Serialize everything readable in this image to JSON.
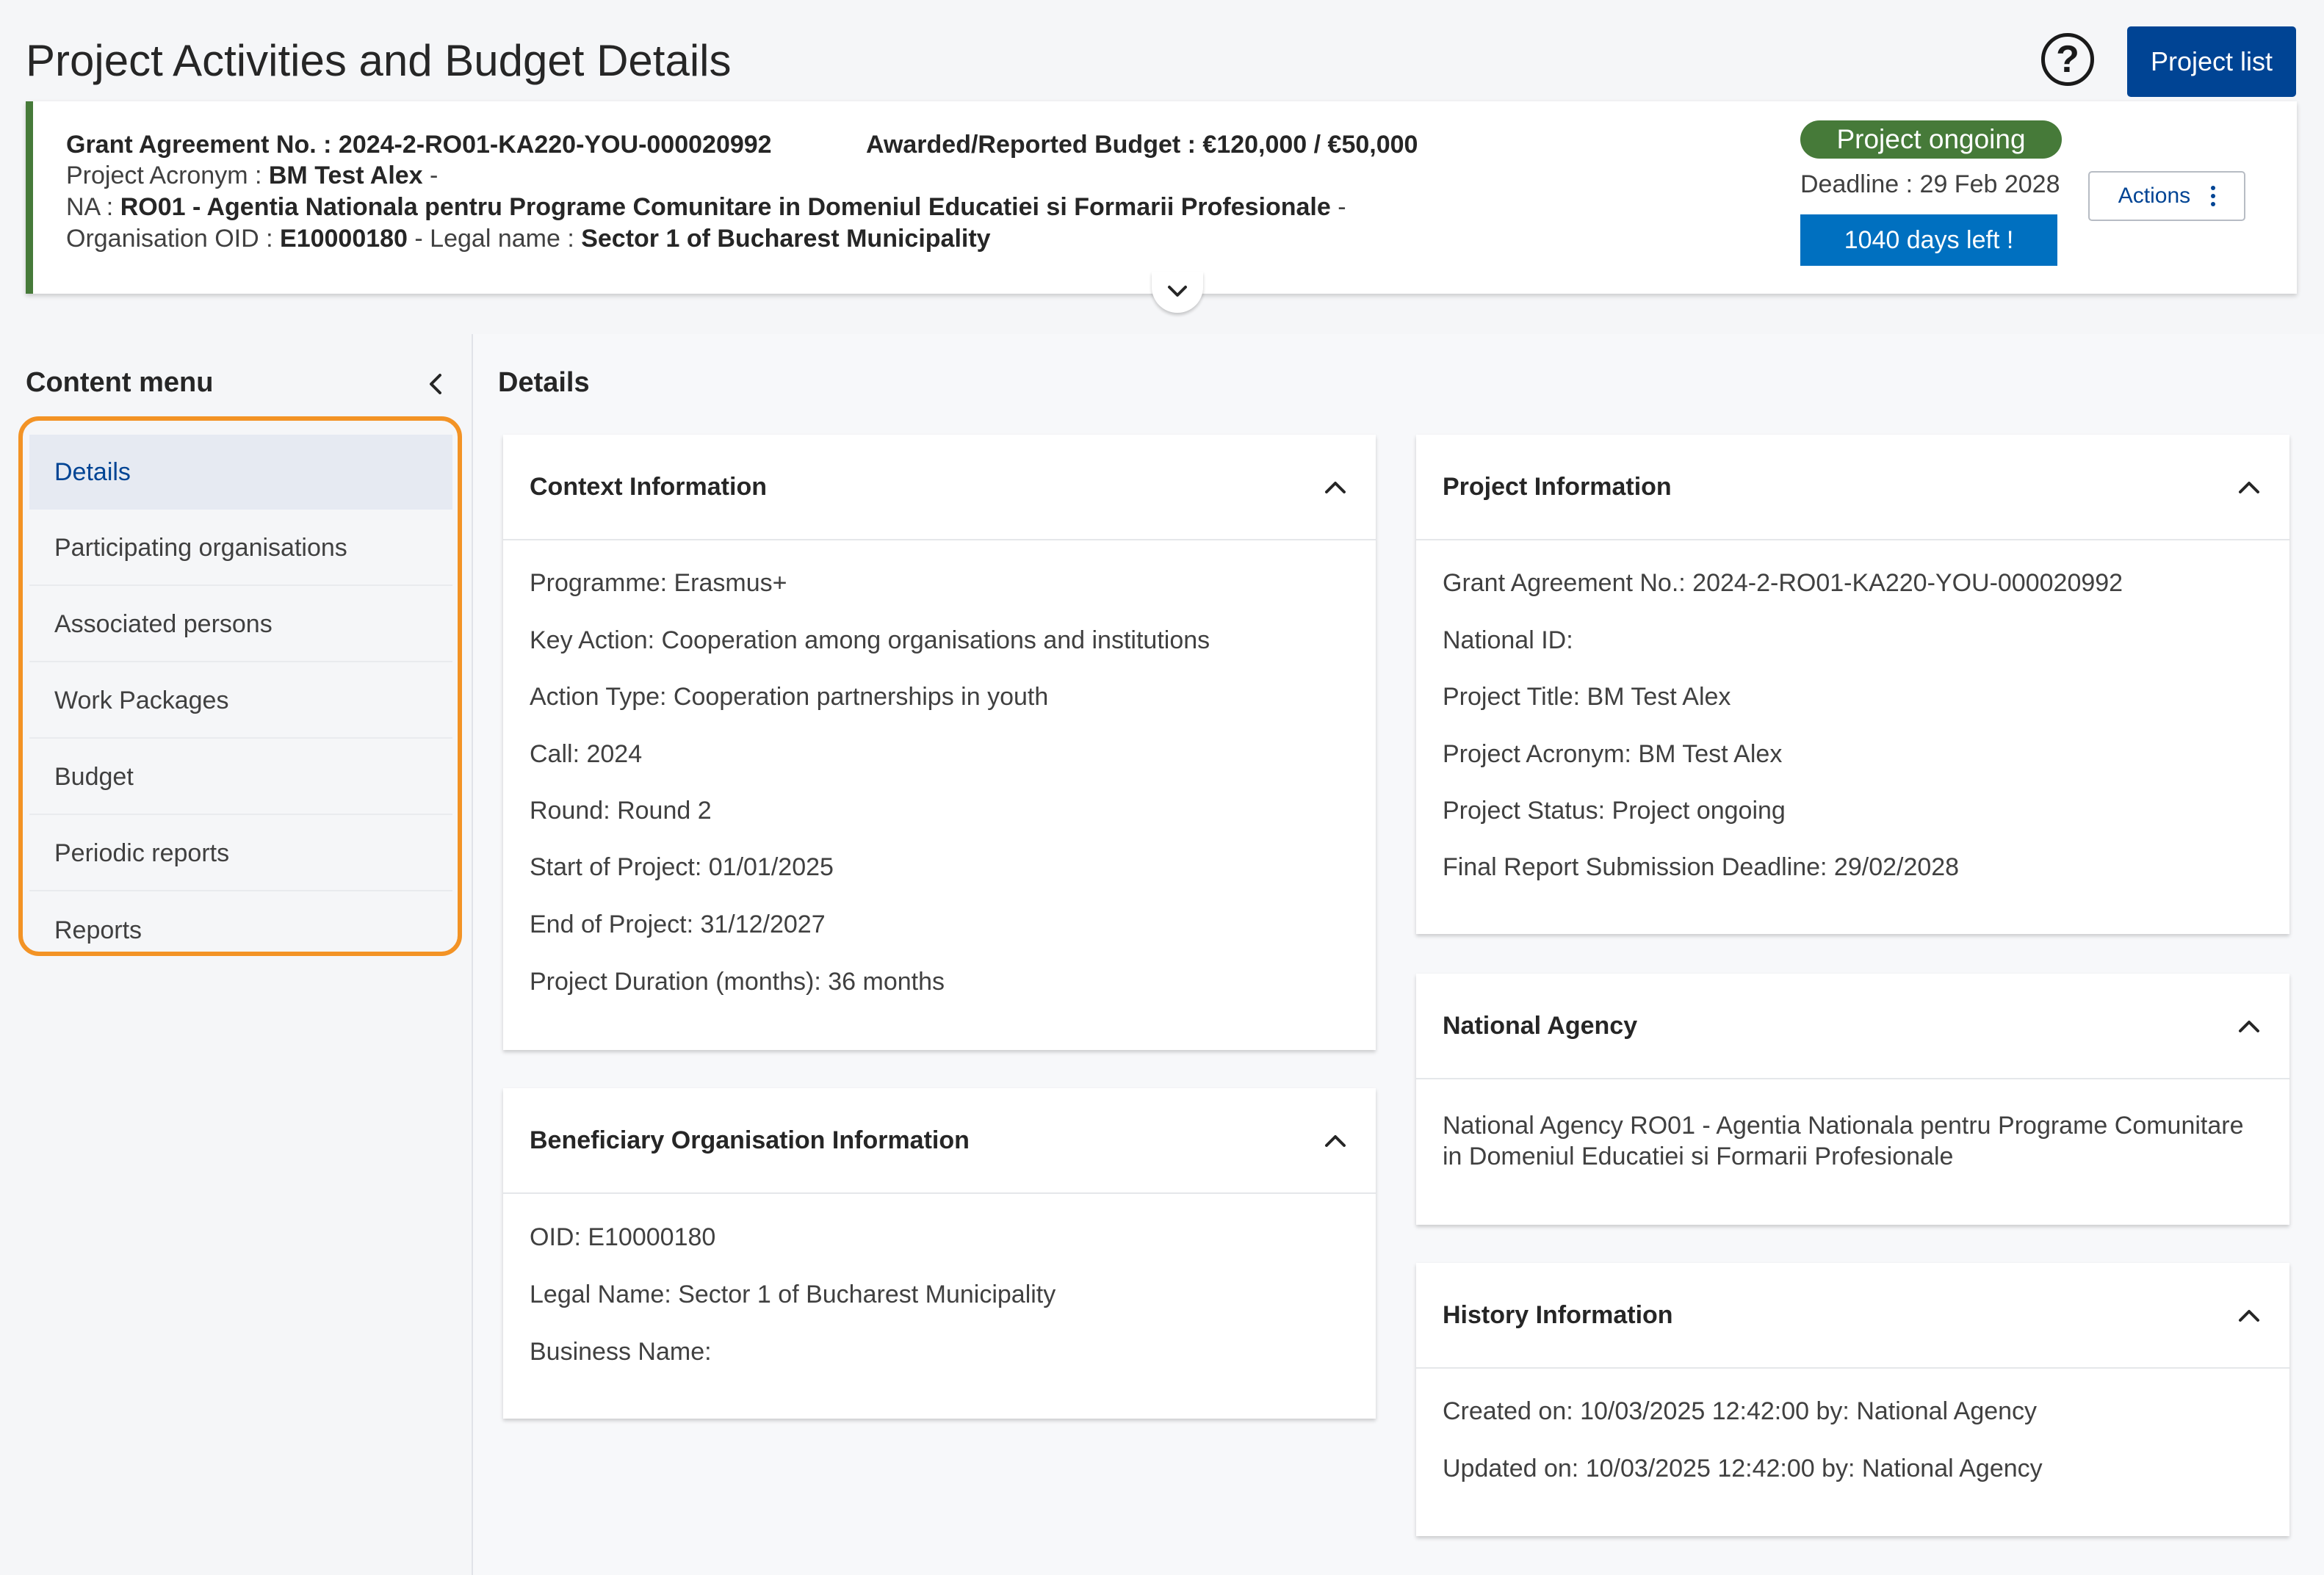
{
  "header": {
    "title": "Project Activities and Budget Details",
    "help_icon": "question-circle-icon",
    "project_list_label": "Project list"
  },
  "summary": {
    "grant_label": "Grant Agreement No. : ",
    "grant_value": "2024-2-RO01-KA220-YOU-000020992",
    "budget_label": "Awarded/Reported Budget : ",
    "budget_value": "€120,000 / €50,000",
    "acronym_label": "Project Acronym : ",
    "acronym_value": "BM Test Alex",
    "acronym_suffix": " -",
    "na_label": "NA : ",
    "na_value": "RO01 - Agentia Nationala pentru Programe Comunitare in Domeniul Educatiei si Formarii Profesionale",
    "na_suffix": " -",
    "oid_label": "Organisation OID : ",
    "oid_value": "E10000180",
    "legal_label": " - Legal name : ",
    "legal_value": "Sector 1 of Bucharest Municipality",
    "status": "Project ongoing",
    "status_color": "#467a39",
    "deadline": "Deadline : 29 Feb 2028",
    "days_left": "1040 days left !",
    "actions_label": "Actions",
    "accent_color": "#004494"
  },
  "menu": {
    "title": "Content menu",
    "items": [
      {
        "label": "Details",
        "active": true
      },
      {
        "label": "Participating organisations"
      },
      {
        "label": "Associated persons"
      },
      {
        "label": "Work Packages"
      },
      {
        "label": "Budget"
      },
      {
        "label": "Periodic reports"
      },
      {
        "label": "Reports"
      }
    ],
    "highlight_color": "#f39325"
  },
  "main": {
    "title": "Details",
    "context": {
      "title": "Context Information",
      "fields": [
        "Programme: Erasmus+",
        "Key Action: Cooperation among organisations and institutions",
        "Action Type: Cooperation partnerships in youth",
        "Call: 2024",
        "Round: Round 2",
        "Start of Project: 01/01/2025",
        "End of Project: 31/12/2027",
        "Project Duration (months): 36 months"
      ]
    },
    "beneficiary": {
      "title": "Beneficiary Organisation Information",
      "fields": [
        "OID: E10000180",
        "Legal Name: Sector 1 of Bucharest Municipality",
        "Business Name:"
      ]
    },
    "project": {
      "title": "Project Information",
      "fields": [
        "Grant Agreement No.: 2024-2-RO01-KA220-YOU-000020992",
        "National ID:",
        "Project Title: BM Test Alex",
        "Project Acronym: BM Test Alex",
        "Project Status: Project ongoing",
        "Final Report Submission Deadline: 29/02/2028"
      ]
    },
    "agency": {
      "title": "National Agency",
      "text": "National Agency RO01 - Agentia Nationala pentru Programe Comunitare in Domeniul Educatiei si Formarii Profesionale"
    },
    "history": {
      "title": "History Information",
      "fields": [
        "Created on: 10/03/2025 12:42:00 by: National Agency",
        "Updated on: 10/03/2025 12:42:00 by: National Agency"
      ]
    }
  }
}
